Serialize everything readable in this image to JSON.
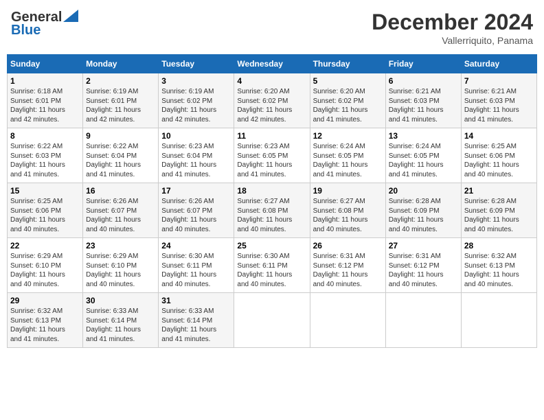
{
  "header": {
    "logo_general": "General",
    "logo_blue": "Blue",
    "month_title": "December 2024",
    "location": "Vallerriquito, Panama"
  },
  "days_of_week": [
    "Sunday",
    "Monday",
    "Tuesday",
    "Wednesday",
    "Thursday",
    "Friday",
    "Saturday"
  ],
  "weeks": [
    [
      {
        "day": "1",
        "sunrise": "6:18 AM",
        "sunset": "6:01 PM",
        "daylight": "11 hours and 42 minutes."
      },
      {
        "day": "2",
        "sunrise": "6:19 AM",
        "sunset": "6:01 PM",
        "daylight": "11 hours and 42 minutes."
      },
      {
        "day": "3",
        "sunrise": "6:19 AM",
        "sunset": "6:02 PM",
        "daylight": "11 hours and 42 minutes."
      },
      {
        "day": "4",
        "sunrise": "6:20 AM",
        "sunset": "6:02 PM",
        "daylight": "11 hours and 42 minutes."
      },
      {
        "day": "5",
        "sunrise": "6:20 AM",
        "sunset": "6:02 PM",
        "daylight": "11 hours and 41 minutes."
      },
      {
        "day": "6",
        "sunrise": "6:21 AM",
        "sunset": "6:03 PM",
        "daylight": "11 hours and 41 minutes."
      },
      {
        "day": "7",
        "sunrise": "6:21 AM",
        "sunset": "6:03 PM",
        "daylight": "11 hours and 41 minutes."
      }
    ],
    [
      {
        "day": "8",
        "sunrise": "6:22 AM",
        "sunset": "6:03 PM",
        "daylight": "11 hours and 41 minutes."
      },
      {
        "day": "9",
        "sunrise": "6:22 AM",
        "sunset": "6:04 PM",
        "daylight": "11 hours and 41 minutes."
      },
      {
        "day": "10",
        "sunrise": "6:23 AM",
        "sunset": "6:04 PM",
        "daylight": "11 hours and 41 minutes."
      },
      {
        "day": "11",
        "sunrise": "6:23 AM",
        "sunset": "6:05 PM",
        "daylight": "11 hours and 41 minutes."
      },
      {
        "day": "12",
        "sunrise": "6:24 AM",
        "sunset": "6:05 PM",
        "daylight": "11 hours and 41 minutes."
      },
      {
        "day": "13",
        "sunrise": "6:24 AM",
        "sunset": "6:05 PM",
        "daylight": "11 hours and 41 minutes."
      },
      {
        "day": "14",
        "sunrise": "6:25 AM",
        "sunset": "6:06 PM",
        "daylight": "11 hours and 40 minutes."
      }
    ],
    [
      {
        "day": "15",
        "sunrise": "6:25 AM",
        "sunset": "6:06 PM",
        "daylight": "11 hours and 40 minutes."
      },
      {
        "day": "16",
        "sunrise": "6:26 AM",
        "sunset": "6:07 PM",
        "daylight": "11 hours and 40 minutes."
      },
      {
        "day": "17",
        "sunrise": "6:26 AM",
        "sunset": "6:07 PM",
        "daylight": "11 hours and 40 minutes."
      },
      {
        "day": "18",
        "sunrise": "6:27 AM",
        "sunset": "6:08 PM",
        "daylight": "11 hours and 40 minutes."
      },
      {
        "day": "19",
        "sunrise": "6:27 AM",
        "sunset": "6:08 PM",
        "daylight": "11 hours and 40 minutes."
      },
      {
        "day": "20",
        "sunrise": "6:28 AM",
        "sunset": "6:09 PM",
        "daylight": "11 hours and 40 minutes."
      },
      {
        "day": "21",
        "sunrise": "6:28 AM",
        "sunset": "6:09 PM",
        "daylight": "11 hours and 40 minutes."
      }
    ],
    [
      {
        "day": "22",
        "sunrise": "6:29 AM",
        "sunset": "6:10 PM",
        "daylight": "11 hours and 40 minutes."
      },
      {
        "day": "23",
        "sunrise": "6:29 AM",
        "sunset": "6:10 PM",
        "daylight": "11 hours and 40 minutes."
      },
      {
        "day": "24",
        "sunrise": "6:30 AM",
        "sunset": "6:11 PM",
        "daylight": "11 hours and 40 minutes."
      },
      {
        "day": "25",
        "sunrise": "6:30 AM",
        "sunset": "6:11 PM",
        "daylight": "11 hours and 40 minutes."
      },
      {
        "day": "26",
        "sunrise": "6:31 AM",
        "sunset": "6:12 PM",
        "daylight": "11 hours and 40 minutes."
      },
      {
        "day": "27",
        "sunrise": "6:31 AM",
        "sunset": "6:12 PM",
        "daylight": "11 hours and 40 minutes."
      },
      {
        "day": "28",
        "sunrise": "6:32 AM",
        "sunset": "6:13 PM",
        "daylight": "11 hours and 40 minutes."
      }
    ],
    [
      {
        "day": "29",
        "sunrise": "6:32 AM",
        "sunset": "6:13 PM",
        "daylight": "11 hours and 41 minutes."
      },
      {
        "day": "30",
        "sunrise": "6:33 AM",
        "sunset": "6:14 PM",
        "daylight": "11 hours and 41 minutes."
      },
      {
        "day": "31",
        "sunrise": "6:33 AM",
        "sunset": "6:14 PM",
        "daylight": "11 hours and 41 minutes."
      },
      null,
      null,
      null,
      null
    ]
  ],
  "labels": {
    "sunrise_prefix": "Sunrise: ",
    "sunset_prefix": "Sunset: ",
    "daylight_prefix": "Daylight: "
  }
}
